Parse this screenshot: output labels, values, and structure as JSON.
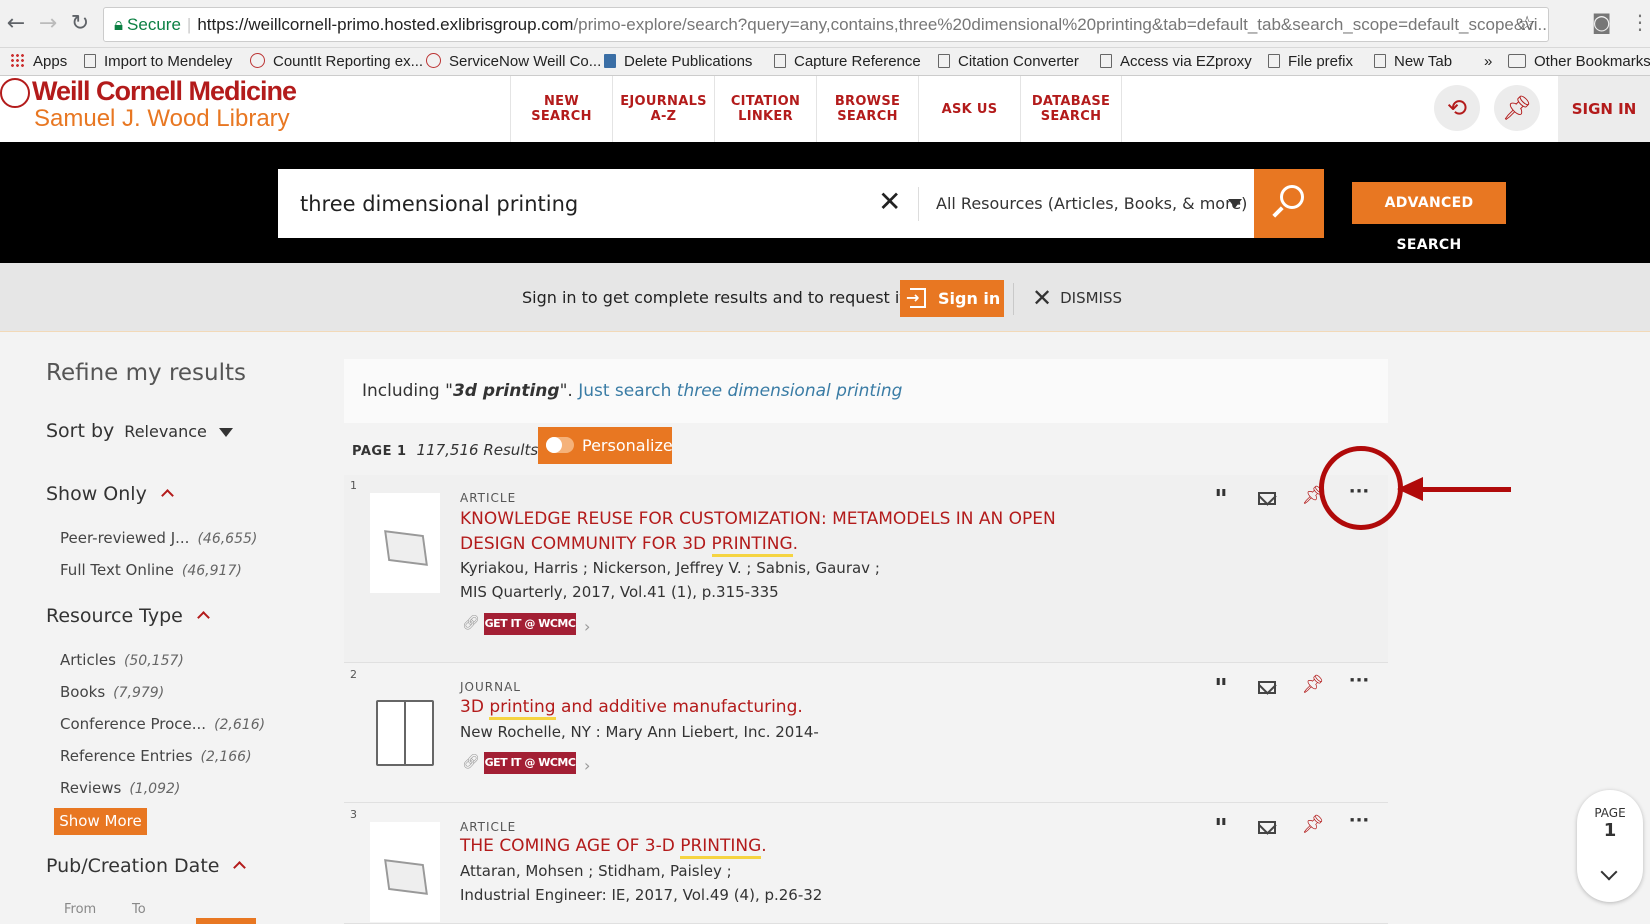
{
  "browser": {
    "secure_label": "Secure",
    "url_host": "https://weillcornell-primo.hosted.exlibrisgroup.com",
    "url_path": "/primo-explore/search?query=any,contains,three%20dimensional%20printing&tab=default_tab&search_scope=default_scope&vi...",
    "bookmarks": [
      "Apps",
      "Import to Mendeley",
      "CountIt Reporting ex...",
      "ServiceNow Weill Co...",
      "Delete Publications",
      "Capture Reference",
      "Citation Converter",
      "Access via EZproxy",
      "File prefix",
      "New Tab",
      "»",
      "Other Bookmarks"
    ]
  },
  "header": {
    "logo_line1": "Weill Cornell Medicine",
    "logo_line2": "Samuel J. Wood Library",
    "nav": [
      "NEW SEARCH",
      "EJOURNALS A-Z",
      "CITATION LINKER",
      "BROWSE SEARCH",
      "ASK US",
      "DATABASE SEARCH"
    ],
    "sign_in": "SIGN IN"
  },
  "search": {
    "query": "three dimensional printing",
    "scope": "All Resources (Articles, Books, & more)",
    "advanced": "ADVANCED SEARCH"
  },
  "signin_bar": {
    "message": "Sign in to get complete results and to request items",
    "button": "Sign in",
    "dismiss": "DISMISS"
  },
  "facets": {
    "refine_title": "Refine my results",
    "sort_label": "Sort by",
    "sort_value": "Relevance",
    "show_only_title": "Show Only",
    "show_only": [
      {
        "label": "Peer-reviewed J...",
        "count": "(46,655)"
      },
      {
        "label": "Full Text Online",
        "count": "(46,917)"
      }
    ],
    "resource_type_title": "Resource Type",
    "resource_types": [
      {
        "label": "Articles",
        "count": "(50,157)"
      },
      {
        "label": "Books",
        "count": "(7,979)"
      },
      {
        "label": "Conference Proce...",
        "count": "(2,616)"
      },
      {
        "label": "Reference Entries",
        "count": "(2,166)"
      },
      {
        "label": "Reviews",
        "count": "(1,092)"
      }
    ],
    "show_more": "Show More",
    "pub_date_title": "Pub/Creation Date",
    "from_label": "From",
    "to_label": "To"
  },
  "results": {
    "including_prefix": "Including \"",
    "including_term": "3d printing",
    "including_suffix": "\". ",
    "just_search_prefix": "Just search ",
    "just_search_term": "three dimensional printing",
    "page_label": "PAGE 1",
    "result_count": "117,516 Results",
    "personalize": "Personalize",
    "items": [
      {
        "num": "1",
        "type": "ARTICLE",
        "title_pre": "KNOWLEDGE REUSE FOR CUSTOMIZATION: METAMODELS IN AN OPEN DESIGN COMMUNITY FOR 3D ",
        "title_hl": "PRINTING",
        "title_post": ".",
        "authors": "Kyriakou, Harris ; Nickerson, Jeffrey V. ; Sabnis, Gaurav ;",
        "source": "MIS Quarterly, 2017, Vol.41 (1), p.315-335",
        "getit": "GET IT @ WCMC"
      },
      {
        "num": "2",
        "type": "JOURNAL",
        "title_pre": "3D ",
        "title_hl": "printing",
        "title_post": " and additive manufacturing.",
        "authors": "New Rochelle, NY : Mary Ann Liebert, Inc. 2014-",
        "getit": "GET IT @ WCMC"
      },
      {
        "num": "3",
        "type": "ARTICLE",
        "title_pre": "THE COMING AGE OF 3-D ",
        "title_hl": "PRINTING",
        "title_post": ".",
        "authors": "Attaran, Mohsen ; Stidham, Paisley ;",
        "source": "Industrial Engineer: IE, 2017, Vol.49 (4), p.26-32"
      }
    ]
  },
  "page_indicator": {
    "label": "PAGE",
    "number": "1"
  },
  "colors": {
    "brand_red": "#b31b1b",
    "accent_orange": "#e87722",
    "annotation_red": "#b00a0a"
  }
}
